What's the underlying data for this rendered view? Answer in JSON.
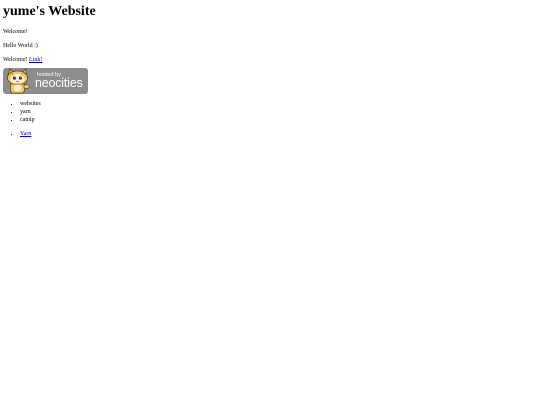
{
  "page": {
    "title": "yume's Website",
    "welcome_text": "Welcome!",
    "hello_text": "Hello World :)",
    "welcome_link_prefix": "Welcome!",
    "link_label": "Link!"
  },
  "badge": {
    "hosted_label": "hosted by",
    "brand_label": "neocities",
    "mascot_icon": "neocities-cat-icon",
    "background_color": "#8c8c8c"
  },
  "lists": {
    "first": [
      "websites",
      "yarn",
      "catnip"
    ],
    "second": [
      "Yarn"
    ]
  }
}
